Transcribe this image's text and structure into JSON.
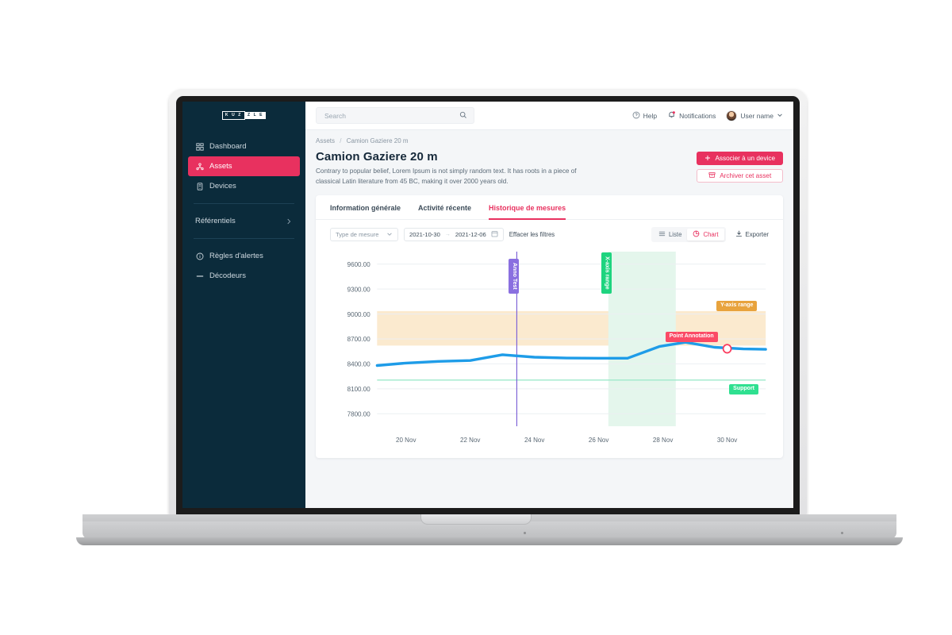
{
  "brand": {
    "logo_dark_text": "K U Z",
    "logo_light_text": "Z L E",
    "accent": "#e8315f",
    "sidebar_bg": "#0b2b3b"
  },
  "sidebar": {
    "items": [
      {
        "label": "Dashboard",
        "icon": "grid-icon",
        "active": false
      },
      {
        "label": "Assets",
        "icon": "asset-icon",
        "active": true
      },
      {
        "label": "Devices",
        "icon": "device-icon",
        "active": false
      },
      {
        "label": "Référentiels",
        "icon": "none",
        "active": false,
        "chevron": "chevron-right-icon"
      },
      {
        "label": "Règles d'alertes",
        "icon": "info-icon",
        "active": false
      },
      {
        "label": "Décodeurs",
        "icon": "decoder-icon",
        "active": false
      }
    ]
  },
  "topbar": {
    "search_placeholder": "Search",
    "search_value": "",
    "help_label": "Help",
    "notifications_label": "Notifications",
    "user_label": "User name"
  },
  "breadcrumb": {
    "root": "Assets",
    "separator": "/",
    "current": "Camion Gaziere 20 m"
  },
  "header": {
    "title": "Camion Gaziere 20 m",
    "description": "Contrary to popular belief, Lorem Ipsum is not simply random text. It has roots in a piece of classical Latin literature from 45 BC, making it over 2000 years old.",
    "primary_button": "Associer à un device",
    "primary_button_icon": "plus-icon",
    "secondary_button": "Archiver cet asset",
    "secondary_button_icon": "archive-icon"
  },
  "tabs": [
    {
      "label": "Information générale",
      "active": false
    },
    {
      "label": "Activité récente",
      "active": false
    },
    {
      "label": "Historique de mesures",
      "active": true
    }
  ],
  "filters": {
    "measure_type_placeholder": "Type de mesure",
    "date_from": "2021-10-30",
    "date_to": "2021-12-06",
    "date_arrow": "→",
    "clear_label": "Effacer les filtres",
    "view_list_label": "Liste",
    "view_chart_label": "Chart",
    "export_label": "Exporter",
    "active_view": "Chart"
  },
  "chart_data": {
    "type": "line",
    "title": "",
    "xlabel": "",
    "ylabel": "",
    "ylim": [
      7650,
      9750
    ],
    "yticks": [
      "7800.00",
      "8100.00",
      "8400.00",
      "8700.00",
      "9000.00",
      "9300.00",
      "9600.00"
    ],
    "ytick_values": [
      7800,
      8100,
      8400,
      8700,
      9000,
      9300,
      9600
    ],
    "xticks": [
      "20 Nov",
      "22 Nov",
      "24 Nov",
      "26 Nov",
      "28 Nov",
      "30 Nov"
    ],
    "xtick_values": [
      20,
      22,
      24,
      26,
      28,
      30
    ],
    "xlim": [
      19.1,
      31.2
    ],
    "grid": true,
    "legend": null,
    "series": [
      {
        "name": "measure",
        "color": "#1e9ce8",
        "x": [
          19.1,
          20.0,
          21.0,
          22.0,
          23.0,
          24.0,
          25.0,
          26.0,
          26.9,
          27.9,
          28.7,
          29.6,
          30.5,
          31.2
        ],
        "values": [
          8380,
          8410,
          8430,
          8440,
          8510,
          8480,
          8470,
          8468,
          8468,
          8610,
          8660,
          8600,
          8580,
          8575
        ]
      }
    ],
    "annotations": [
      {
        "name": "Anno Test",
        "kind": "x-line",
        "x": 23.45,
        "color": "#7b5fd6",
        "label_color": "#8a6fe0",
        "text_color": "#ffffff"
      },
      {
        "name": "X-axis range",
        "kind": "x-range",
        "x_from": 26.3,
        "x_to": 28.4,
        "color": "#e4f6ec",
        "label_color": "#1ed47f",
        "text_color": "#ffffff"
      },
      {
        "name": "Y-axis range",
        "kind": "y-range",
        "y_from": 8620,
        "y_to": 9035,
        "color": "#fbeacf",
        "label_color": "#e8a33d",
        "text_color": "#ffffff"
      },
      {
        "name": "Point Annotation",
        "kind": "point",
        "x": 30.0,
        "y": 8582,
        "color": "#fb3b5c",
        "label_color": "#fb4a66",
        "text_color": "#ffffff"
      },
      {
        "name": "Support",
        "kind": "y-line",
        "y": 8205,
        "color": "#9fe8cb",
        "label_color": "#2fe090",
        "text_color": "#ffffff"
      }
    ]
  }
}
